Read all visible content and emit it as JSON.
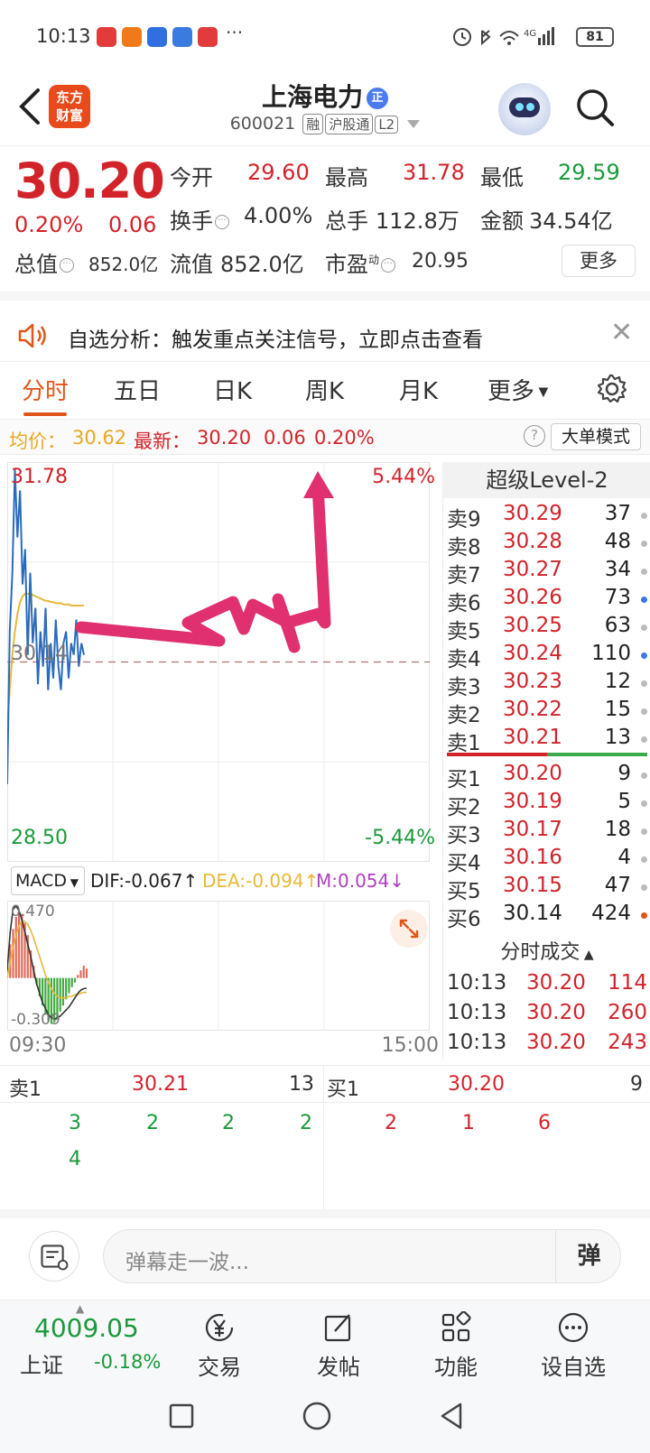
{
  "status_bar": {
    "time": "10:13",
    "overflow": "···",
    "signal": "4G",
    "battery": "81",
    "app_icon_colors": [
      "#e23b3b",
      "#f07a1a",
      "#2f6fe0",
      "#3a7be0",
      "#e23b3b"
    ]
  },
  "header": {
    "logo_line1": "东方",
    "logo_line2": "财富",
    "stock_name": "上海电力",
    "name_badge": "正",
    "code": "600021",
    "tags": [
      "融",
      "沪股通",
      "L2"
    ]
  },
  "quote": {
    "price": "30.20",
    "change_pct": "0.20%",
    "change": "0.06",
    "fields": {
      "open_label": "今开",
      "open": "29.60",
      "high_label": "最高",
      "high": "31.78",
      "low_label": "最低",
      "low": "29.59",
      "turnover_label": "换手",
      "turnover": "4.00%",
      "volume_label": "总手",
      "volume": "112.8万",
      "amount_label": "金额",
      "amount": "34.54亿",
      "mktcap_label": "总值",
      "mktcap": "852.0亿",
      "float_label": "流值",
      "float": "852.0亿",
      "pe_label": "市盈",
      "pe_sup": "动",
      "pe": "20.95"
    },
    "more": "更多"
  },
  "notice": {
    "text": "自选分析：触发重点关注信号，立即点击查看"
  },
  "tabs": [
    "分时",
    "五日",
    "日K",
    "周K",
    "月K",
    "更多"
  ],
  "active_tab": 0,
  "avg_line": {
    "avg_label": "均价：",
    "avg": "30.62",
    "last_label": "最新：",
    "last": "30.20",
    "chg": "0.06",
    "pct": "0.20%",
    "help": "?",
    "big_order_mode": "大单模式"
  },
  "chart": {
    "high_label": "31.78",
    "low_label": "28.50",
    "up_pct": "5.44%",
    "down_pct": "-5.44%",
    "ref_label": "30.14",
    "start_time": "09:30",
    "end_time": "15:00",
    "prev_close": 30.14,
    "y_max": 31.78,
    "y_min": 28.5,
    "price_series": [
      29.1,
      30.4,
      30.9,
      31.78,
      31.2,
      31.6,
      30.8,
      31.1,
      30.2,
      30.9,
      30.3,
      30.6,
      29.95,
      30.4,
      30.1,
      30.6,
      29.9,
      30.3,
      30.0,
      30.5,
      30.1,
      29.9,
      30.3,
      30.4,
      30.0,
      30.3,
      30.2,
      30.5,
      30.1,
      30.3,
      30.2
    ],
    "avg_series": [
      29.6,
      29.9,
      30.2,
      30.4,
      30.55,
      30.65,
      30.7,
      30.72,
      30.72,
      30.72,
      30.71,
      30.7,
      30.69,
      30.68,
      30.67,
      30.66,
      30.66,
      30.65,
      30.65,
      30.64,
      30.64,
      30.64,
      30.63,
      30.63,
      30.63,
      30.62,
      30.62,
      30.62,
      30.62,
      30.62,
      30.62
    ],
    "line_color": "#2a6bbd",
    "avg_color": "#e8b83a",
    "annotation_color": "#e0306f"
  },
  "macd": {
    "selector": "MACD",
    "dif": "DIF:-0.067↑",
    "dea": "DEA:-0.094↑",
    "m": "M:0.054↓",
    "top_label": "0.470",
    "bottom_label": "-0.309",
    "hist": [
      0.1,
      0.22,
      0.32,
      0.4,
      0.44,
      0.42,
      0.36,
      0.28,
      0.18,
      0.08,
      -0.04,
      -0.12,
      -0.18,
      -0.24,
      -0.28,
      -0.3,
      -0.29,
      -0.26,
      -0.22,
      -0.18,
      -0.14,
      -0.1,
      -0.06,
      -0.03,
      0.02,
      0.05,
      0.08,
      0.06
    ],
    "dif_line": [
      0.05,
      0.3,
      0.45,
      0.47,
      0.44,
      0.38,
      0.3,
      0.22,
      0.14,
      0.05,
      -0.04,
      -0.1,
      -0.16,
      -0.2,
      -0.24,
      -0.26,
      -0.27,
      -0.26,
      -0.25,
      -0.23,
      -0.21,
      -0.19,
      -0.16,
      -0.13,
      -0.1,
      -0.08,
      -0.07,
      -0.067
    ],
    "dea_line": [
      0.0,
      0.1,
      0.2,
      0.28,
      0.34,
      0.37,
      0.37,
      0.35,
      0.31,
      0.26,
      0.2,
      0.14,
      0.08,
      0.02,
      -0.03,
      -0.07,
      -0.1,
      -0.12,
      -0.13,
      -0.13,
      -0.13,
      -0.12,
      -0.12,
      -0.11,
      -0.11,
      -0.1,
      -0.095,
      -0.094
    ]
  },
  "order_book": {
    "title": "超级Level-2",
    "asks": [
      {
        "label": "卖9",
        "price": "30.29",
        "vol": "37",
        "dot": "#bbbbbb"
      },
      {
        "label": "卖8",
        "price": "30.28",
        "vol": "48",
        "dot": "#bbbbbb"
      },
      {
        "label": "卖7",
        "price": "30.27",
        "vol": "34",
        "dot": "#bbbbbb"
      },
      {
        "label": "卖6",
        "price": "30.26",
        "vol": "73",
        "dot": "#3a7be0"
      },
      {
        "label": "卖5",
        "price": "30.25",
        "vol": "63",
        "dot": "#bbbbbb"
      },
      {
        "label": "卖4",
        "price": "30.24",
        "vol": "110",
        "dot": "#3a7be0"
      },
      {
        "label": "卖3",
        "price": "30.23",
        "vol": "12",
        "dot": "#bbbbbb"
      },
      {
        "label": "卖2",
        "price": "30.22",
        "vol": "15",
        "dot": "#bbbbbb"
      },
      {
        "label": "卖1",
        "price": "30.21",
        "vol": "13",
        "dot": "#bbbbbb"
      }
    ],
    "bids": [
      {
        "label": "买1",
        "price": "30.20",
        "vol": "9",
        "dot": "#bbbbbb"
      },
      {
        "label": "买2",
        "price": "30.19",
        "vol": "5",
        "dot": "#bbbbbb"
      },
      {
        "label": "买3",
        "price": "30.17",
        "vol": "18",
        "dot": "#bbbbbb"
      },
      {
        "label": "买4",
        "price": "30.16",
        "vol": "4",
        "dot": "#bbbbbb"
      },
      {
        "label": "买5",
        "price": "30.15",
        "vol": "47",
        "dot": "#bbbbbb"
      },
      {
        "label": "买6",
        "price": "30.14",
        "vol": "424",
        "dot": "#e0561a"
      }
    ],
    "trades_title": "分时成交",
    "trades": [
      {
        "time": "10:13",
        "price": "30.20",
        "vol": "114"
      },
      {
        "time": "10:13",
        "price": "30.20",
        "vol": "260"
      },
      {
        "time": "10:13",
        "price": "30.20",
        "vol": "243"
      }
    ]
  },
  "detail": {
    "ask_label": "卖1",
    "ask_price": "30.21",
    "ask_vol": "13",
    "bid_label": "买1",
    "bid_price": "30.20",
    "bid_vol": "9",
    "ask_orders": [
      "3",
      "2",
      "2",
      "2",
      "4"
    ],
    "bid_orders": [
      "2",
      "1",
      "6"
    ]
  },
  "comment": {
    "placeholder": "弹幕走一波...",
    "danmu": "弹"
  },
  "bottom_nav": {
    "index_value": "4009.05",
    "index_name": "上证",
    "index_pct": "-0.18%",
    "items": [
      "交易",
      "发帖",
      "功能",
      "设自选"
    ]
  }
}
